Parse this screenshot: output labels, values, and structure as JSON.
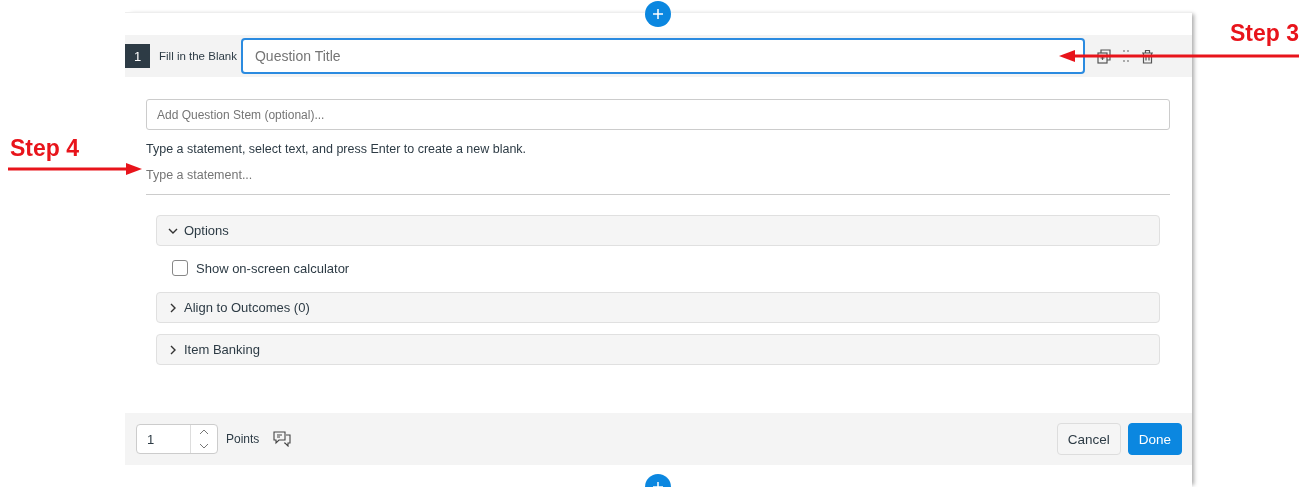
{
  "question": {
    "number": "1",
    "type_label": "Fill in the Blank",
    "title": {
      "placeholder": "Question Title",
      "focused": true
    }
  },
  "stem": {
    "placeholder": "Add Question Stem (optional)..."
  },
  "instructions": "Type a statement, select text, and press Enter to create a new blank.",
  "statement": {
    "placeholder": "Type a statement..."
  },
  "sections": [
    {
      "kind": "panel",
      "label": "Options",
      "expanded": true
    },
    {
      "kind": "checkbox",
      "label": "Show on-screen calculator",
      "checked": false
    },
    {
      "kind": "panel",
      "label": "Align to Outcomes (0)",
      "expanded": false
    },
    {
      "kind": "panel",
      "label": "Item Banking",
      "expanded": false
    }
  ],
  "footer": {
    "points": {
      "value": "1",
      "label": "Points"
    },
    "buttons": [
      {
        "label": "Cancel",
        "primary": false
      },
      {
        "label": "Done",
        "primary": true
      }
    ]
  },
  "annotations": [
    {
      "label": "Step 3",
      "kind": "right"
    },
    {
      "label": "Step 4",
      "kind": "left"
    }
  ]
}
